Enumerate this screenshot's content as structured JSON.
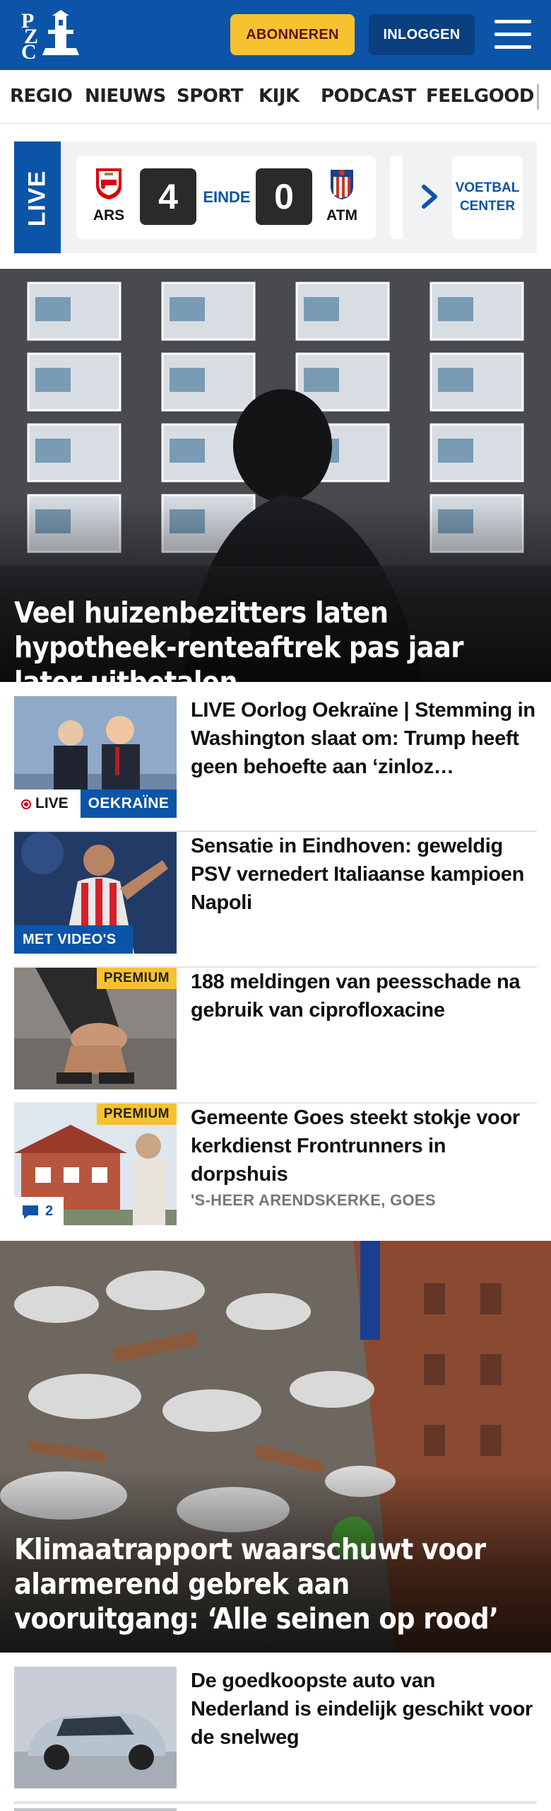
{
  "header": {
    "logo_letters": [
      "P",
      "Z",
      "C"
    ],
    "subscribe_label": "ABONNEREN",
    "login_label": "INLOGGEN",
    "menu_icon": "hamburger-menu-icon",
    "brand_color": "#0b54a8",
    "accent_color": "#f6c230"
  },
  "nav": {
    "items": [
      "REGIO",
      "NIEUWS",
      "SPORT",
      "KIJK",
      "PODCAST",
      "FEELGOOD"
    ]
  },
  "livebar": {
    "live_label": "LIVE",
    "match": {
      "home_abbr": "ARS",
      "home_score": "4",
      "status": "EINDE",
      "away_score": "0",
      "away_abbr": "ATM"
    },
    "center_label_line1": "VOETBAL",
    "center_label_line2": "CENTER"
  },
  "hero1": {
    "title": "Veel huizenbezitters laten hypotheek-renteaftrek pas jaar later uitbetalen"
  },
  "articles": [
    {
      "title": "LIVE Oorlog Oekraïne | Stemming in Washington slaat om: Trump heeft geen behoefte aan ‘zinloz…",
      "live_label": "LIVE",
      "section_label": "OEKRAÏNE"
    },
    {
      "title": "Sensatie in Eindhoven: geweldig PSV vernedert Italiaanse kampioen Napoli",
      "video_label": "MET VIDEO'S"
    },
    {
      "title": "188 meldingen van peesschade na gebruik van ciprofloxacine",
      "premium_label": "PREMIUM"
    },
    {
      "title": "Gemeente Goes steekt stokje voor kerkdienst Frontrunners in dorpshuis",
      "premium_label": "PREMIUM",
      "location": "'S-HEER ARENDSKERKE, GOES",
      "comments": "2"
    }
  ],
  "hero2": {
    "title": "Klimaatrapport waarschuwt voor alarmerend gebrek aan vooruitgang: ‘Alle seinen op rood’"
  },
  "articles2": [
    {
      "title": "De goedkoopste auto van Nederland is eindelijk geschikt voor de snelweg"
    }
  ]
}
